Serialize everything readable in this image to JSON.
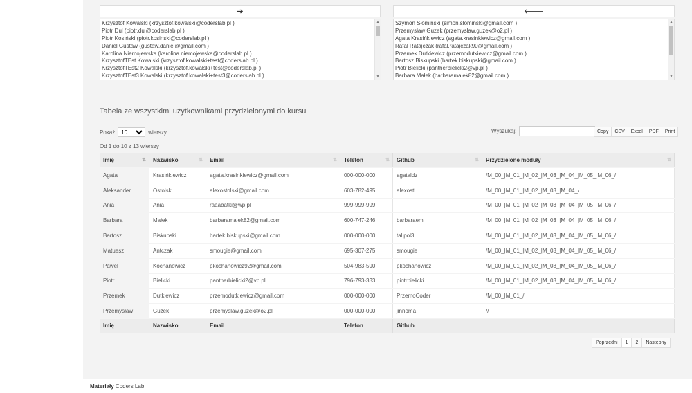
{
  "transfer": {
    "add_arrow": "➔",
    "remove_arrow": "🡐",
    "available_users": [
      "Krzysztof Kowalski (krzysztof.kowalski@coderslab.pl )",
      "Piotr Dul (piotr.dul@coderslab.pl )",
      "Piotr Kosiński (piotr.kosinski@coderslab.pl )",
      "Daniel Gustaw (gustaw.daniel@gmail.com )",
      "Karolina Niemojewska (karolina.niemojewska@coderslab.pl )",
      "KrzysztofTEst Kowalski (krzysztof.kowalski+test@coderslab.pl )",
      "KrzysztofTEst2 Kowalski (krzysztof.kowalski+test@coderslab.pl )",
      "KrzysztofTEst3 Kowalski (krzysztof.kowalski+test3@coderslab.pl )"
    ],
    "assigned_users": [
      "Szymon Słomiński (simon.slominski@gmail.com )",
      "Przemysław Guzek (przemyslaw.guzek@o2.pl )",
      "Agata Krasińkiewicz (agata.krasinkiewicz@gmail.com )",
      "Rafał Ratajczak (rafal.ratajczak90@gmail.com )",
      "Przemek Dutkiewicz (przemodutkiewicz@gmail.com )",
      "Bartosz Biskupski (bartek.biskupski@gmail.com )",
      "Piotr Bielicki (pantherbielicki2@vp.pl )",
      "Barbara Małek (barbaramalek82@gmail.com )"
    ]
  },
  "section_title": "Tabela ze wszystkimi użytkownikami przydzielonymi do kursu",
  "length_control": {
    "prefix": "Pokaż",
    "selected": "10",
    "suffix": "wierszy"
  },
  "search": {
    "label": "Wyszukaj:",
    "value": ""
  },
  "export_buttons": [
    "Copy",
    "CSV",
    "Excel",
    "PDF",
    "Print"
  ],
  "info_text": "Od 1 do 10 z 13 wierszy",
  "table": {
    "columns": [
      "Imię",
      "Nazwisko",
      "Email",
      "Telefon",
      "Github",
      "Przydzielone moduły"
    ],
    "rows": [
      [
        "Agata",
        "Krasińkiewicz",
        "agata.krasinkiewicz@gmail.com",
        "000-000-000",
        "agataldz",
        "/M_00_|M_01_|M_02_|M_03_|M_04_|M_05_|M_06_/"
      ],
      [
        "Aleksander",
        "Ostolski",
        "alexostolski@gmail.com",
        "603-782-495",
        "alexostl",
        "/M_00_|M_01_|M_02_|M_03_|M_04_/"
      ],
      [
        "Ania",
        "Ania",
        "raaabatki@wp.pl",
        "999-999-999",
        "",
        "/M_00_|M_01_|M_02_|M_03_|M_04_|M_05_|M_06_/"
      ],
      [
        "Barbara",
        "Małek",
        "barbaramalek82@gmail.com",
        "600-747-246",
        "barbaraem",
        "/M_00_|M_01_|M_02_|M_03_|M_04_|M_05_|M_06_/"
      ],
      [
        "Bartosz",
        "Biskupski",
        "bartek.biskupski@gmail.com",
        "000-000-000",
        "tallpol3",
        "/M_00_|M_01_|M_02_|M_03_|M_04_|M_05_|M_06_/"
      ],
      [
        "Matuesz",
        "Antczak",
        "smougie@gmail.com",
        "695-307-275",
        "smougie",
        "/M_00_|M_01_|M_02_|M_03_|M_04_|M_05_|M_06_/"
      ],
      [
        "Paweł",
        "Kochanowicz",
        "pkochanowicz92@gmail.com",
        "504-983-590",
        "pkochanowicz",
        "/M_00_|M_01_|M_02_|M_03_|M_04_|M_05_|M_06_/"
      ],
      [
        "Piotr",
        "Bielicki",
        "pantherbielicki2@vp.pl",
        "796-793-333",
        "piotrbielicki",
        "/M_00_|M_01_|M_02_|M_03_|M_04_|M_05_|M_06_/"
      ],
      [
        "Przemek",
        "Dutkiewicz",
        "przemodutkiewicz@gmail.com",
        "000-000-000",
        "PrzemoCoder",
        "/M_00_|M_01_/"
      ],
      [
        "Przemysław",
        "Guzek",
        "przemyslaw.guzek@o2.pl",
        "000-000-000",
        "jinnoma",
        "//"
      ]
    ],
    "footer_columns": [
      "Imię",
      "Nazwisko",
      "Email",
      "Telefon",
      "Github",
      ""
    ]
  },
  "pagination": {
    "previous": "Poprzedni",
    "pages": [
      "1",
      "2"
    ],
    "current": "1",
    "next": "Następny"
  },
  "footer": {
    "brand": "Materiały",
    "text": " Coders Lab"
  }
}
